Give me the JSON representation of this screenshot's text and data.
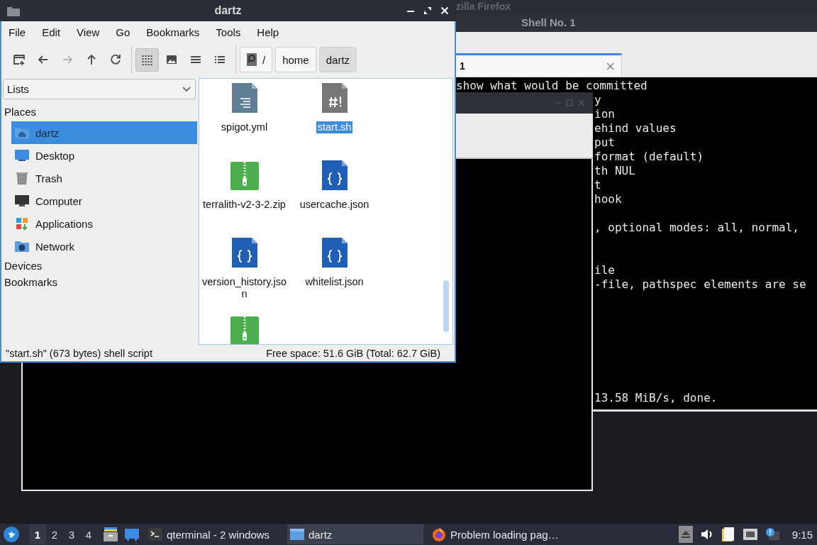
{
  "firefox_window": {
    "title": "zilla Firefox"
  },
  "terminal_window": {
    "title": "Shell No. 1",
    "tabs": [
      {
        "label": "1",
        "selected": true
      }
    ],
    "top_line": "show what would be committed",
    "visible_blocks": [
      [
        "y",
        "ion",
        "ehind values",
        "put",
        "format (default)",
        "th NUL",
        "t",
        "hook"
      ],
      [
        ", optional modes: all, normal,"
      ],
      [
        "ile",
        "-file, pathspec elements are se"
      ],
      [
        "13.58 MiB/s, done."
      ]
    ]
  },
  "file_manager": {
    "title": "dartz",
    "menu": [
      "File",
      "Edit",
      "View",
      "Go",
      "Bookmarks",
      "Tools",
      "Help"
    ],
    "nav_buttons": [
      {
        "kind": "new-tab",
        "disabled": false
      },
      {
        "kind": "back",
        "disabled": false
      },
      {
        "kind": "forward",
        "disabled": true
      },
      {
        "kind": "up",
        "disabled": false
      },
      {
        "kind": "reload",
        "disabled": false
      }
    ],
    "view_modes": [
      {
        "kind": "icons",
        "selected": true
      },
      {
        "kind": "thumbnails",
        "selected": false
      },
      {
        "kind": "compact",
        "selected": false
      },
      {
        "kind": "details",
        "selected": false
      }
    ],
    "path": [
      {
        "label": "/",
        "kind": "root",
        "selected": false
      },
      {
        "label": "home",
        "kind": "folder",
        "selected": false
      },
      {
        "label": "dartz",
        "kind": "folder",
        "selected": true
      }
    ],
    "side_pane": {
      "mode": "Lists",
      "places_heading": "Places",
      "places": [
        {
          "label": "dartz",
          "kind": "home",
          "selected": true
        },
        {
          "label": "Desktop",
          "kind": "desktop",
          "selected": false
        },
        {
          "label": "Trash",
          "kind": "trash",
          "selected": false
        },
        {
          "label": "Computer",
          "kind": "computer",
          "selected": false
        },
        {
          "label": "Applications",
          "kind": "applications",
          "selected": false
        },
        {
          "label": "Network",
          "kind": "network",
          "selected": false
        }
      ],
      "sections": [
        "Devices",
        "Bookmarks"
      ]
    },
    "files": [
      {
        "name": "spigot.yml",
        "kind": "text",
        "selected": false
      },
      {
        "name": "start.sh",
        "kind": "script",
        "selected": true
      },
      {
        "name": "terralith-v2-3-2.zip",
        "kind": "zip",
        "selected": false
      },
      {
        "name": "usercache.json",
        "kind": "json",
        "selected": false
      },
      {
        "name": "version_history.json",
        "kind": "json",
        "selected": false
      },
      {
        "name": "whitelist.json",
        "kind": "json",
        "selected": false
      },
      {
        "kind": "zip",
        "selected": false
      }
    ],
    "status": {
      "selection": "\"start.sh\" (673 bytes) shell script",
      "free_space": "Free space: 51.6 GiB (Total: 62.7 GiB)"
    }
  },
  "taskbar": {
    "workspaces": [
      {
        "label": "1",
        "selected": true
      },
      {
        "label": "2",
        "selected": false
      },
      {
        "label": "3",
        "selected": false
      },
      {
        "label": "4",
        "selected": false
      }
    ],
    "tasks": [
      {
        "label": "qterminal - 2 windows",
        "kind": "terminal",
        "selected": false
      },
      {
        "label": "dartz",
        "kind": "folder",
        "selected": true
      },
      {
        "label": "Problem loading pag…",
        "kind": "browser",
        "selected": false
      }
    ],
    "clock": "9:15"
  }
}
